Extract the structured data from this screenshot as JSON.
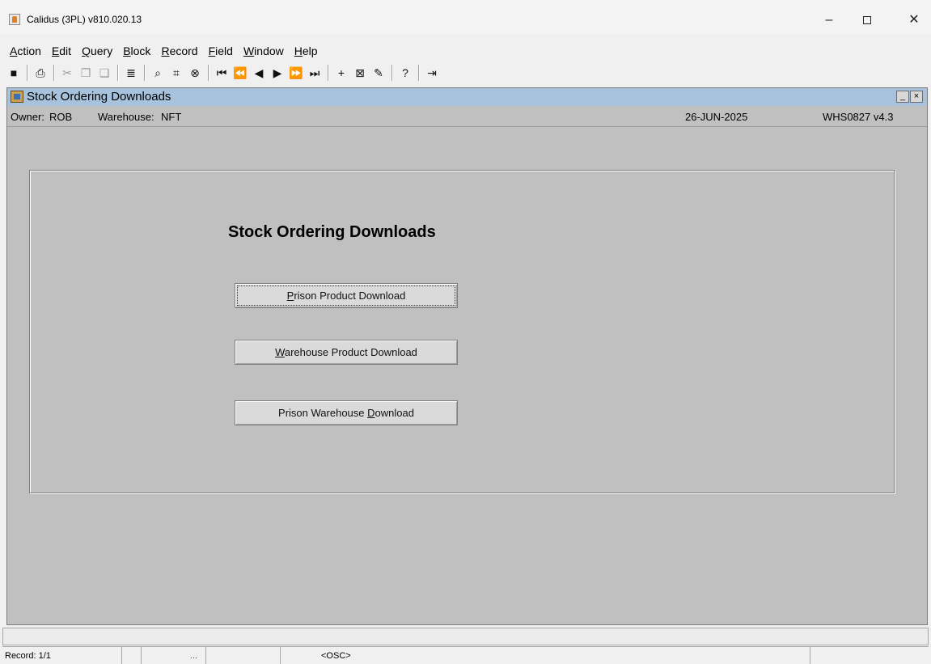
{
  "window": {
    "title": "Calidus (3PL) v810.020.13",
    "controls": {
      "minimize": "–",
      "close": "✕"
    }
  },
  "menu": [
    {
      "pre": "",
      "acc": "A",
      "post": "ction"
    },
    {
      "pre": "",
      "acc": "E",
      "post": "dit"
    },
    {
      "pre": "",
      "acc": "Q",
      "post": "uery"
    },
    {
      "pre": "",
      "acc": "B",
      "post": "lock"
    },
    {
      "pre": "",
      "acc": "R",
      "post": "ecord"
    },
    {
      "pre": "",
      "acc": "F",
      "post": "ield"
    },
    {
      "pre": "",
      "acc": "W",
      "post": "indow"
    },
    {
      "pre": "",
      "acc": "H",
      "post": "elp"
    }
  ],
  "toolbar": {
    "save_icon": "■",
    "print_icon": "⎙",
    "cut_icon": "✂",
    "copy_icon": "❐",
    "paste_icon": "❏",
    "list_icon": "≣",
    "enter_query_icon": "⌕",
    "execute_query_icon": "⌗",
    "cancel_query_icon": "⊗",
    "first_block_icon": "⏮",
    "prev_block_icon": "⏪",
    "prev_record_icon": "◀",
    "next_record_icon": "▶",
    "next_block_icon": "⏩",
    "last_block_icon": "⏭",
    "insert_icon": "+",
    "delete_icon": "⊠",
    "clear_icon": "✎",
    "help_icon": "?",
    "exit_icon": "⇥"
  },
  "form": {
    "title": "Stock Ordering Downloads",
    "controls": {
      "minimize": "_",
      "close": "×"
    },
    "owner_label": "Owner:",
    "owner_value": "ROB",
    "warehouse_label": "Warehouse:",
    "warehouse_value": "NFT",
    "date": "26-JUN-2025",
    "version": "WHS0827  v4.3",
    "heading": "Stock Ordering Downloads",
    "buttons": [
      {
        "pre": "",
        "acc": "P",
        "post": "rison Product Download"
      },
      {
        "pre": "",
        "acc": "W",
        "post": "arehouse Product Download"
      },
      {
        "pre": "Prison Warehouse ",
        "acc": "D",
        "post": "ownload"
      }
    ]
  },
  "status": {
    "record": "Record: 1/1",
    "ellipsis": "...",
    "mode": "<OSC>"
  }
}
